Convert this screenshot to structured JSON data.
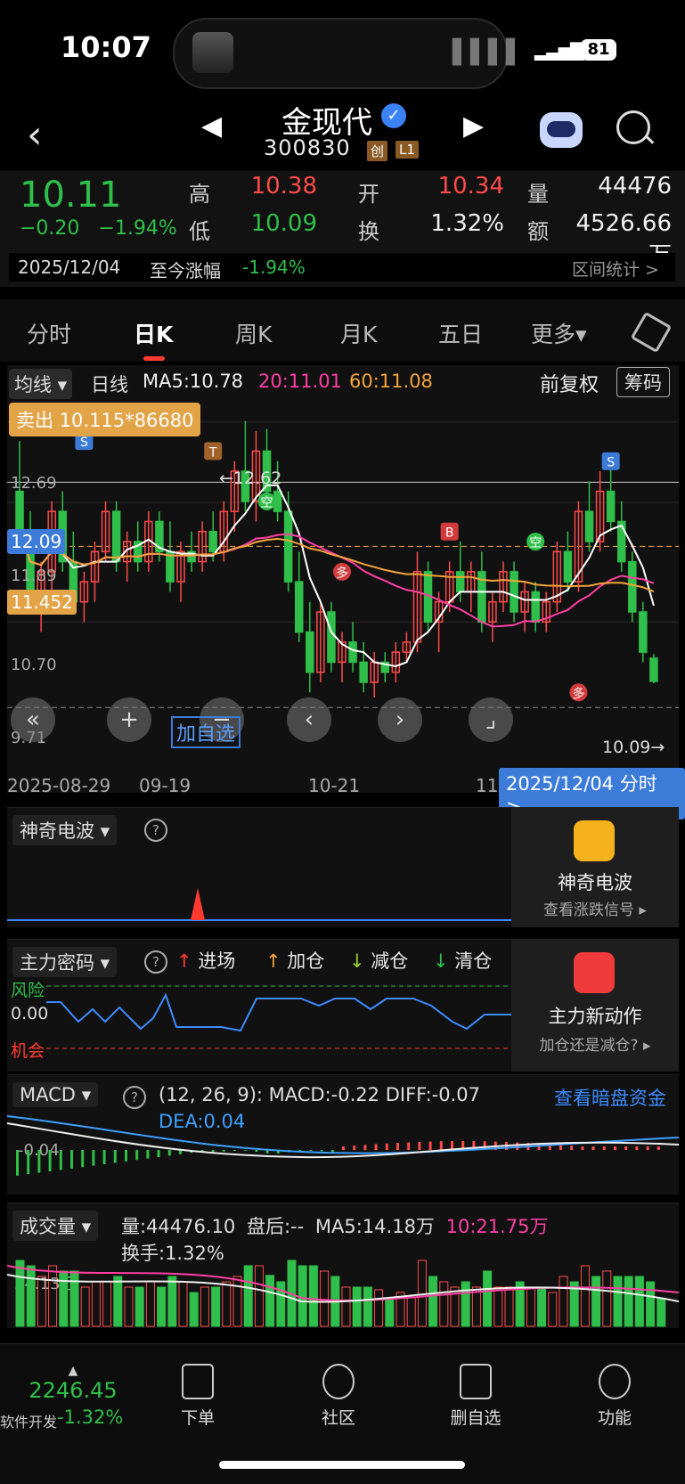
{
  "status_bar": {
    "time": "10:07",
    "battery": "81",
    "island_media_icon": "music-wave-icon"
  },
  "header": {
    "stock_name": "金现代",
    "stock_code": "300830",
    "tags": [
      "创",
      "L1"
    ],
    "icons": [
      "back-icon",
      "prev-stock-icon",
      "next-stock-icon",
      "robot-assistant-icon",
      "search-icon"
    ]
  },
  "quote": {
    "price": "10.11",
    "change": "−0.20",
    "change_pct": "−1.94%",
    "high_label": "高",
    "high": "10.38",
    "open_label": "开",
    "open": "10.34",
    "volume_label": "量",
    "volume": "44476",
    "low_label": "低",
    "low": "10.09",
    "turnover_label": "换",
    "turnover": "1.32%",
    "amount_label": "额",
    "amount": "4526.66万",
    "date": "2025/12/04",
    "since_label": "至今涨幅",
    "since_value": "-1.94%",
    "range_stat": "区间统计 >"
  },
  "tabs": [
    "分时",
    "日K",
    "周K",
    "月K",
    "五日",
    "更多▾"
  ],
  "active_tab": "日K",
  "chart_header": {
    "ma_select": "均线",
    "period": "日线",
    "ma5": "MA5:10.78",
    "ma20": "20:11.01",
    "ma60": "60:11.08",
    "adjust": "前复权",
    "chips": "筹码",
    "sell_box": "卖出 10.115*86680"
  },
  "chart_data": {
    "type": "candlestick",
    "y_axis_labels": [
      "12.69",
      "11.89",
      "10.70",
      "9.71"
    ],
    "price_tags": [
      "12.09",
      "11.452"
    ],
    "annotations": [
      "←12.62",
      "10.09→"
    ],
    "x_labels": [
      "2025-08-29",
      "09-19",
      "10-21",
      "11"
    ],
    "signal_labels": [
      "S",
      "B",
      "T",
      "空",
      "多"
    ],
    "colors": {
      "ma5": "#ffffff",
      "ma20": "#ff3fa4",
      "ma60": "#f3a43b",
      "up": "#ff4a4a",
      "down": "#2fbf4a"
    },
    "candles": [
      {
        "o": 12.0,
        "h": 12.5,
        "l": 11.5,
        "c": 11.6
      },
      {
        "o": 11.6,
        "h": 11.8,
        "l": 10.9,
        "c": 11.0
      },
      {
        "o": 11.0,
        "h": 11.3,
        "l": 10.6,
        "c": 11.2
      },
      {
        "o": 11.2,
        "h": 11.9,
        "l": 11.0,
        "c": 11.8
      },
      {
        "o": 11.8,
        "h": 12.0,
        "l": 11.2,
        "c": 11.3
      },
      {
        "o": 11.3,
        "h": 11.6,
        "l": 10.8,
        "c": 10.9
      },
      {
        "o": 10.9,
        "h": 11.2,
        "l": 10.7,
        "c": 11.1
      },
      {
        "o": 11.1,
        "h": 11.5,
        "l": 10.9,
        "c": 11.4
      },
      {
        "o": 11.4,
        "h": 11.9,
        "l": 11.3,
        "c": 11.8
      },
      {
        "o": 11.8,
        "h": 11.9,
        "l": 11.2,
        "c": 11.3
      },
      {
        "o": 11.3,
        "h": 11.6,
        "l": 11.1,
        "c": 11.5
      },
      {
        "o": 11.5,
        "h": 11.7,
        "l": 11.2,
        "c": 11.3
      },
      {
        "o": 11.3,
        "h": 11.8,
        "l": 11.2,
        "c": 11.7
      },
      {
        "o": 11.7,
        "h": 11.8,
        "l": 11.3,
        "c": 11.4
      },
      {
        "o": 11.4,
        "h": 11.7,
        "l": 11.0,
        "c": 11.1
      },
      {
        "o": 11.1,
        "h": 11.5,
        "l": 10.9,
        "c": 11.4
      },
      {
        "o": 11.4,
        "h": 11.6,
        "l": 11.2,
        "c": 11.3
      },
      {
        "o": 11.3,
        "h": 11.7,
        "l": 11.2,
        "c": 11.6
      },
      {
        "o": 11.6,
        "h": 11.8,
        "l": 11.3,
        "c": 11.4
      },
      {
        "o": 11.4,
        "h": 11.9,
        "l": 11.3,
        "c": 11.8
      },
      {
        "o": 11.8,
        "h": 12.3,
        "l": 11.6,
        "c": 12.2
      },
      {
        "o": 12.2,
        "h": 12.7,
        "l": 11.8,
        "c": 11.9
      },
      {
        "o": 11.9,
        "h": 12.6,
        "l": 11.7,
        "c": 12.4
      },
      {
        "o": 12.4,
        "h": 12.62,
        "l": 11.9,
        "c": 12.0
      },
      {
        "o": 12.0,
        "h": 12.3,
        "l": 11.7,
        "c": 11.8
      },
      {
        "o": 11.8,
        "h": 12.0,
        "l": 11.0,
        "c": 11.1
      },
      {
        "o": 11.1,
        "h": 11.4,
        "l": 10.5,
        "c": 10.6
      },
      {
        "o": 10.6,
        "h": 10.9,
        "l": 10.0,
        "c": 10.2
      },
      {
        "o": 10.2,
        "h": 10.9,
        "l": 10.1,
        "c": 10.8
      },
      {
        "o": 10.8,
        "h": 10.9,
        "l": 10.2,
        "c": 10.3
      },
      {
        "o": 10.3,
        "h": 10.6,
        "l": 10.1,
        "c": 10.5
      },
      {
        "o": 10.5,
        "h": 10.7,
        "l": 10.2,
        "c": 10.3
      },
      {
        "o": 10.3,
        "h": 10.5,
        "l": 10.0,
        "c": 10.1
      },
      {
        "o": 10.1,
        "h": 10.4,
        "l": 9.95,
        "c": 10.3
      },
      {
        "o": 10.3,
        "h": 10.4,
        "l": 10.1,
        "c": 10.2
      },
      {
        "o": 10.2,
        "h": 10.5,
        "l": 10.1,
        "c": 10.4
      },
      {
        "o": 10.4,
        "h": 10.6,
        "l": 10.3,
        "c": 10.5
      },
      {
        "o": 10.5,
        "h": 11.4,
        "l": 10.4,
        "c": 11.2
      },
      {
        "o": 11.2,
        "h": 11.3,
        "l": 10.6,
        "c": 10.7
      },
      {
        "o": 10.7,
        "h": 11.0,
        "l": 10.4,
        "c": 10.9
      },
      {
        "o": 10.9,
        "h": 11.3,
        "l": 10.8,
        "c": 11.2
      },
      {
        "o": 11.2,
        "h": 11.5,
        "l": 10.9,
        "c": 11.0
      },
      {
        "o": 11.0,
        "h": 11.3,
        "l": 10.8,
        "c": 11.2
      },
      {
        "o": 11.2,
        "h": 11.4,
        "l": 10.6,
        "c": 10.7
      },
      {
        "o": 10.7,
        "h": 11.0,
        "l": 10.5,
        "c": 10.9
      },
      {
        "o": 10.9,
        "h": 11.3,
        "l": 10.8,
        "c": 11.2
      },
      {
        "o": 11.2,
        "h": 11.3,
        "l": 10.7,
        "c": 10.8
      },
      {
        "o": 10.8,
        "h": 11.1,
        "l": 10.6,
        "c": 11.0
      },
      {
        "o": 11.0,
        "h": 11.1,
        "l": 10.6,
        "c": 10.7
      },
      {
        "o": 10.7,
        "h": 11.0,
        "l": 10.6,
        "c": 10.9
      },
      {
        "o": 10.9,
        "h": 11.5,
        "l": 10.8,
        "c": 11.4
      },
      {
        "o": 11.4,
        "h": 11.6,
        "l": 11.0,
        "c": 11.1
      },
      {
        "o": 11.1,
        "h": 11.9,
        "l": 11.0,
        "c": 11.8
      },
      {
        "o": 11.8,
        "h": 12.1,
        "l": 11.4,
        "c": 11.5
      },
      {
        "o": 11.5,
        "h": 12.2,
        "l": 11.4,
        "c": 12.0
      },
      {
        "o": 12.0,
        "h": 12.3,
        "l": 11.6,
        "c": 11.7
      },
      {
        "o": 11.7,
        "h": 11.9,
        "l": 11.2,
        "c": 11.3
      },
      {
        "o": 11.3,
        "h": 11.4,
        "l": 10.7,
        "c": 10.8
      },
      {
        "o": 10.8,
        "h": 10.9,
        "l": 10.3,
        "c": 10.4
      },
      {
        "o": 10.34,
        "h": 10.38,
        "l": 10.09,
        "c": 10.11
      }
    ]
  },
  "wave_panel": {
    "selector": "神奇电波",
    "card_title": "神奇电波",
    "card_sub": "查看涨跌信号 ▸"
  },
  "mainforce_panel": {
    "selector": "主力密码",
    "legend": [
      "进场",
      "加仓",
      "减仓",
      "清仓"
    ],
    "risk": "风险",
    "zero": "0.00",
    "chance": "机会",
    "card_title": "主力新动作",
    "card_sub": "加仓还是减仓? ▸"
  },
  "macd_panel": {
    "selector": "MACD",
    "params": "(12, 26, 9):",
    "macd": "MACD:-0.22",
    "diff": "DIFF:-0.07",
    "dea": "DEA:0.04",
    "axis": "-0.04",
    "link": "查看暗盘资金"
  },
  "volume_panel": {
    "selector": "成交量",
    "vol": "量:44476.10",
    "after": "盘后:--",
    "ma5": "MA5:14.18万",
    "ma10": "10:21.75万",
    "turnover": "换手:1.32%",
    "axis": "24.13万"
  },
  "bottom_nav": {
    "index_value": "2246.45",
    "index_name": "软件开发",
    "index_change": "-1.32%",
    "items": [
      "下单",
      "社区",
      "删自选",
      "功能"
    ]
  }
}
